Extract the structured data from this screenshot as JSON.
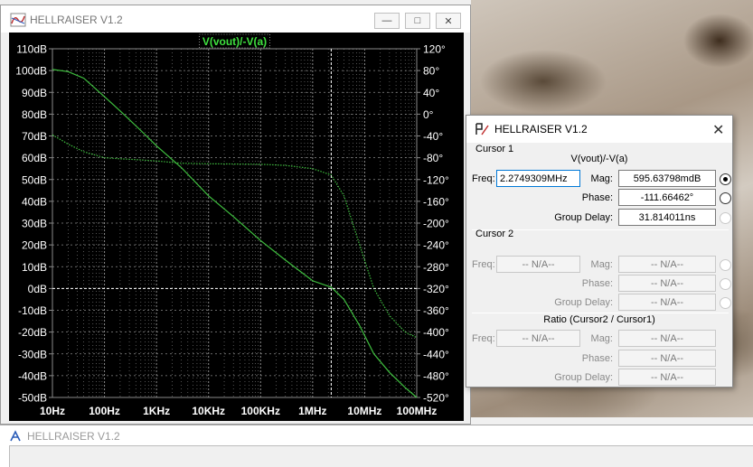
{
  "app_title": "HELLRAISER V1.2",
  "plot_window": {
    "title": "HELLRAISER V1.2",
    "buttons": {
      "minimize": "—",
      "maximize": "□",
      "close": "✕"
    }
  },
  "chart_data": {
    "type": "line",
    "title": "V(vout)/-V(a)",
    "x_scale": "log",
    "xlim": [
      10,
      100000000
    ],
    "x_ticks": [
      "10Hz",
      "100Hz",
      "1KHz",
      "10KHz",
      "100KHz",
      "1MHz",
      "10MHz",
      "100MHz"
    ],
    "y_left_ticks": [
      "110dB",
      "100dB",
      "90dB",
      "80dB",
      "70dB",
      "60dB",
      "50dB",
      "40dB",
      "30dB",
      "20dB",
      "10dB",
      "0dB",
      "-10dB",
      "-20dB",
      "-30dB",
      "-40dB",
      "-50dB"
    ],
    "y_right_ticks": [
      "120°",
      "80°",
      "40°",
      "0°",
      "-40°",
      "-80°",
      "-120°",
      "-160°",
      "-200°",
      "-240°",
      "-280°",
      "-320°",
      "-360°",
      "-400°",
      "-440°",
      "-480°",
      "-520°"
    ],
    "ylim_left": [
      -50,
      110
    ],
    "ylim_right": [
      -520,
      120
    ],
    "grid": true,
    "cursor_x": 2274930.9,
    "series": [
      {
        "name": "magnitude",
        "axis": "left",
        "line_style": "solid",
        "x": [
          10,
          20,
          40,
          100,
          200,
          500,
          1000,
          3000,
          10000,
          30000,
          100000,
          300000,
          1000000,
          2274930.9,
          4000000,
          8000000,
          15000000,
          30000000,
          60000000,
          100000000
        ],
        "y": [
          100.5,
          99.5,
          96.5,
          88,
          81.5,
          72.5,
          65.5,
          55.5,
          42.5,
          33,
          22,
          13,
          3.5,
          0.6,
          -5,
          -17,
          -30,
          -38.5,
          -45.5,
          -50
        ]
      },
      {
        "name": "phase",
        "axis": "right",
        "line_style": "dotted",
        "x": [
          10,
          20,
          40,
          100,
          200,
          500,
          1000,
          3000,
          10000,
          100000,
          300000,
          1000000,
          2274930.9,
          4000000,
          8000000,
          15000000,
          30000000,
          60000000,
          100000000
        ],
        "y": [
          -38,
          -55,
          -69,
          -80,
          -82,
          -84,
          -86,
          -90,
          -91,
          -92,
          -94,
          -100,
          -111.66,
          -150,
          -240,
          -320,
          -370,
          -400,
          -410
        ]
      }
    ]
  },
  "cursor_dialog": {
    "title": "HELLRAISER V1.2",
    "close": "✕",
    "cursor1": {
      "header": "Cursor 1",
      "trace": "V(vout)/-V(a)",
      "freq_label": "Freq:",
      "freq_value": "2.2749309MHz",
      "mag_label": "Mag:",
      "mag_value": "595.63798mdB",
      "phase_label": "Phase:",
      "phase_value": "-111.66462°",
      "gd_label": "Group Delay:",
      "gd_value": "31.814011ns"
    },
    "cursor2": {
      "header": "Cursor 2",
      "freq_label": "Freq:",
      "freq_value": "-- N/A--",
      "mag_label": "Mag:",
      "mag_value": "-- N/A--",
      "phase_label": "Phase:",
      "phase_value": "-- N/A--",
      "gd_label": "Group Delay:",
      "gd_value": "-- N/A--"
    },
    "ratio": {
      "header": "Ratio (Cursor2 / Cursor1)",
      "freq_label": "Freq:",
      "freq_value": "-- N/A--",
      "mag_label": "Mag:",
      "mag_value": "-- N/A--",
      "phase_label": "Phase:",
      "phase_value": "-- N/A--",
      "gd_label": "Group Delay:",
      "gd_value": "-- N/A--"
    }
  },
  "bottom_window": {
    "title": "HELLRAISER V1.2"
  },
  "colors": {
    "plot_bg": "#000000",
    "trace": "#3fbf3f",
    "grid": "#8a8a8a",
    "axis_text": "#ffffff",
    "title_text": "#3fe03f",
    "cursor_line": "#ffffff"
  }
}
